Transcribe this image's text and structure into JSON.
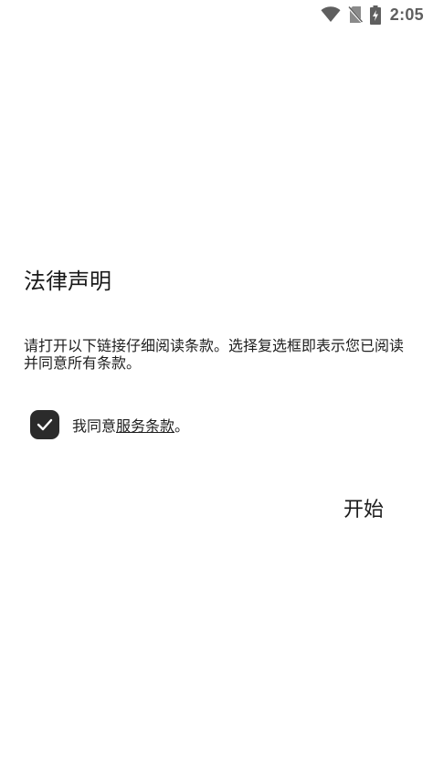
{
  "status_bar": {
    "time": "2:05",
    "icons": [
      "wifi-icon",
      "no-sim-icon",
      "battery-charging-icon"
    ],
    "icon_color": "#5f5f5f"
  },
  "legal": {
    "title": "法律声明",
    "description": "请打开以下链接仔细阅读条款。选择复选框即表示您已阅读并同意所有条款。",
    "agree_prefix": "我同意",
    "terms_link": "服务条款",
    "agree_suffix": "。",
    "agree_checked": true,
    "checkbox_color": "#2b2b2b"
  },
  "actions": {
    "start_label": "开始"
  }
}
